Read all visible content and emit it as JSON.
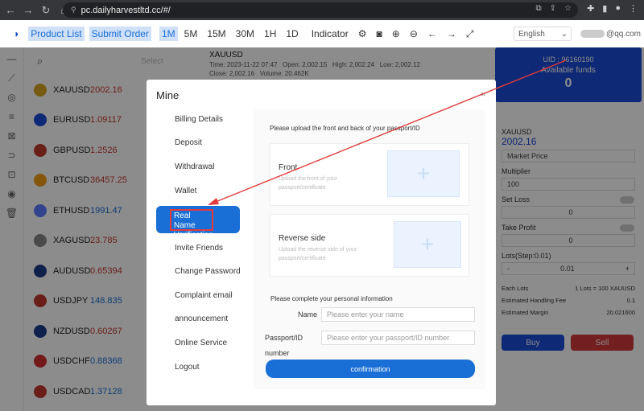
{
  "browser": {
    "url": "pc.dailyharvestltd.cc/#/"
  },
  "toolbar": {
    "product_list": "Product List",
    "submit_order": "Submit Order",
    "timeframes": [
      "1M",
      "5M",
      "15M",
      "30M",
      "1H",
      "1D"
    ],
    "indicator": "Indicator",
    "language": "English",
    "email_suffix": "@qq.com"
  },
  "search": {
    "select_placeholder": "Select"
  },
  "symbols": [
    {
      "name": "XAUUSD",
      "price": "2002.16",
      "color": "#c0392b"
    },
    {
      "name": "EURUSD",
      "price": "1.09117",
      "color": "#c0392b"
    },
    {
      "name": "GBPUSD",
      "price": "1.2526",
      "color": "#c0392b"
    },
    {
      "name": "BTCUSD",
      "price": "36457.25",
      "color": "#c0392b"
    },
    {
      "name": "ETHUSD",
      "price": "1991.47",
      "color": "#1a6fd6"
    },
    {
      "name": "XAGUSD",
      "price": "23.785",
      "color": "#c0392b"
    },
    {
      "name": "AUDUSD",
      "price": "0.65394",
      "color": "#c0392b"
    },
    {
      "name": "USDJPY",
      "price": "148.835",
      "color": "#1a6fd6"
    },
    {
      "name": "NZDUSD",
      "price": "0.60267",
      "color": "#c0392b"
    },
    {
      "name": "USDCHF",
      "price": "0.88368",
      "color": "#1a6fd6"
    },
    {
      "name": "USDCAD",
      "price": "1.37128",
      "color": "#1a6fd6"
    }
  ],
  "chart_header": {
    "symbol": "XAUUSD",
    "time": "Time: 2023-11-22 07:47",
    "open": "Open: 2,002.15",
    "high": "High: 2,002.24",
    "low": "Low: 2,002.12",
    "close": "Close: 2,002.16",
    "volume": "Volume: 20.462K"
  },
  "account": {
    "uid": "UID : 96160190",
    "available_label": "Available funds",
    "available_value": "0"
  },
  "trade_panel": {
    "symbol": "XAUUSD",
    "price": "2002.16",
    "order_type": "Market Price",
    "multiplier_label": "Multiplier",
    "multiplier_value": "100",
    "stop_loss_label": "Set Loss",
    "stop_loss_value": "0",
    "take_profit_label": "Take Profit",
    "take_profit_value": "0",
    "lots_label": "Lots(Step:0.01)",
    "lots_value": "0.01",
    "minus": "-",
    "plus": "+",
    "each_lots_label": "Each Lots",
    "each_lots_value": "1 Lots = 100 XAUUSD",
    "fee_label": "Estimated Handling Fee",
    "fee_value": "0.1",
    "margin_label": "Estimated Margin",
    "margin_value": "20.021600",
    "buy": "Buy",
    "sell": "Sell"
  },
  "modal": {
    "title": "Mine",
    "close": "×",
    "menu": [
      "Billing Details",
      "Deposit",
      "Withdrawal",
      "Wallet",
      "Real Name Verification",
      "Invite Friends",
      "Change Password",
      "Complaint email",
      "announcement",
      "Online Service",
      "Logout"
    ],
    "upload_instruction": "Please upload the front and back of your passport/ID",
    "front_title": "Front",
    "front_sub": "Upload the front of your passport/certificate",
    "reverse_title": "Reverse side",
    "reverse_sub": "Upload the reverse side of your passport/certificate",
    "info_title": "Please complete your personal information",
    "name_label": "Name",
    "name_placeholder": "Please enter your name",
    "passport_label": "Passport/ID",
    "passport_label2": "number",
    "passport_placeholder": "Please enter your passport/ID number",
    "confirm": "confirmation"
  },
  "colors": {
    "accent": "#1a6fd6",
    "annotation_red": "#e13b3b"
  }
}
